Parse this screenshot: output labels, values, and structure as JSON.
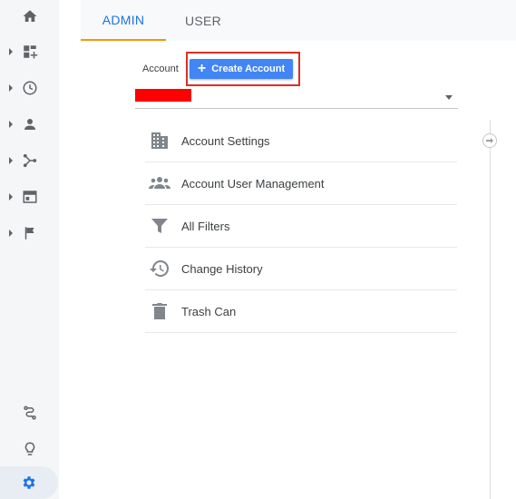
{
  "tabs": {
    "admin": "ADMIN",
    "user": "USER"
  },
  "account": {
    "label": "Account",
    "create_button": "Create Account",
    "create_button_icon": "plus-icon"
  },
  "list": {
    "items": [
      {
        "label": "Account Settings",
        "icon": "building-icon"
      },
      {
        "label": "Account User Management",
        "icon": "people-icon"
      },
      {
        "label": "All Filters",
        "icon": "filter-icon"
      },
      {
        "label": "Change History",
        "icon": "history-icon"
      },
      {
        "label": "Trash Can",
        "icon": "trash-icon"
      }
    ]
  },
  "rail": {
    "icons": [
      "home-icon",
      "dashboard-icon",
      "clock-icon",
      "person-icon",
      "acquisition-icon",
      "behavior-icon",
      "flag-icon",
      "route-icon",
      "lightbulb-icon",
      "gear-icon"
    ]
  },
  "colors": {
    "accent": "#1a73e8",
    "tab_indicator": "#f29900",
    "button": "#4285f4",
    "highlight": "#d93025",
    "redaction": "#ff0000"
  }
}
